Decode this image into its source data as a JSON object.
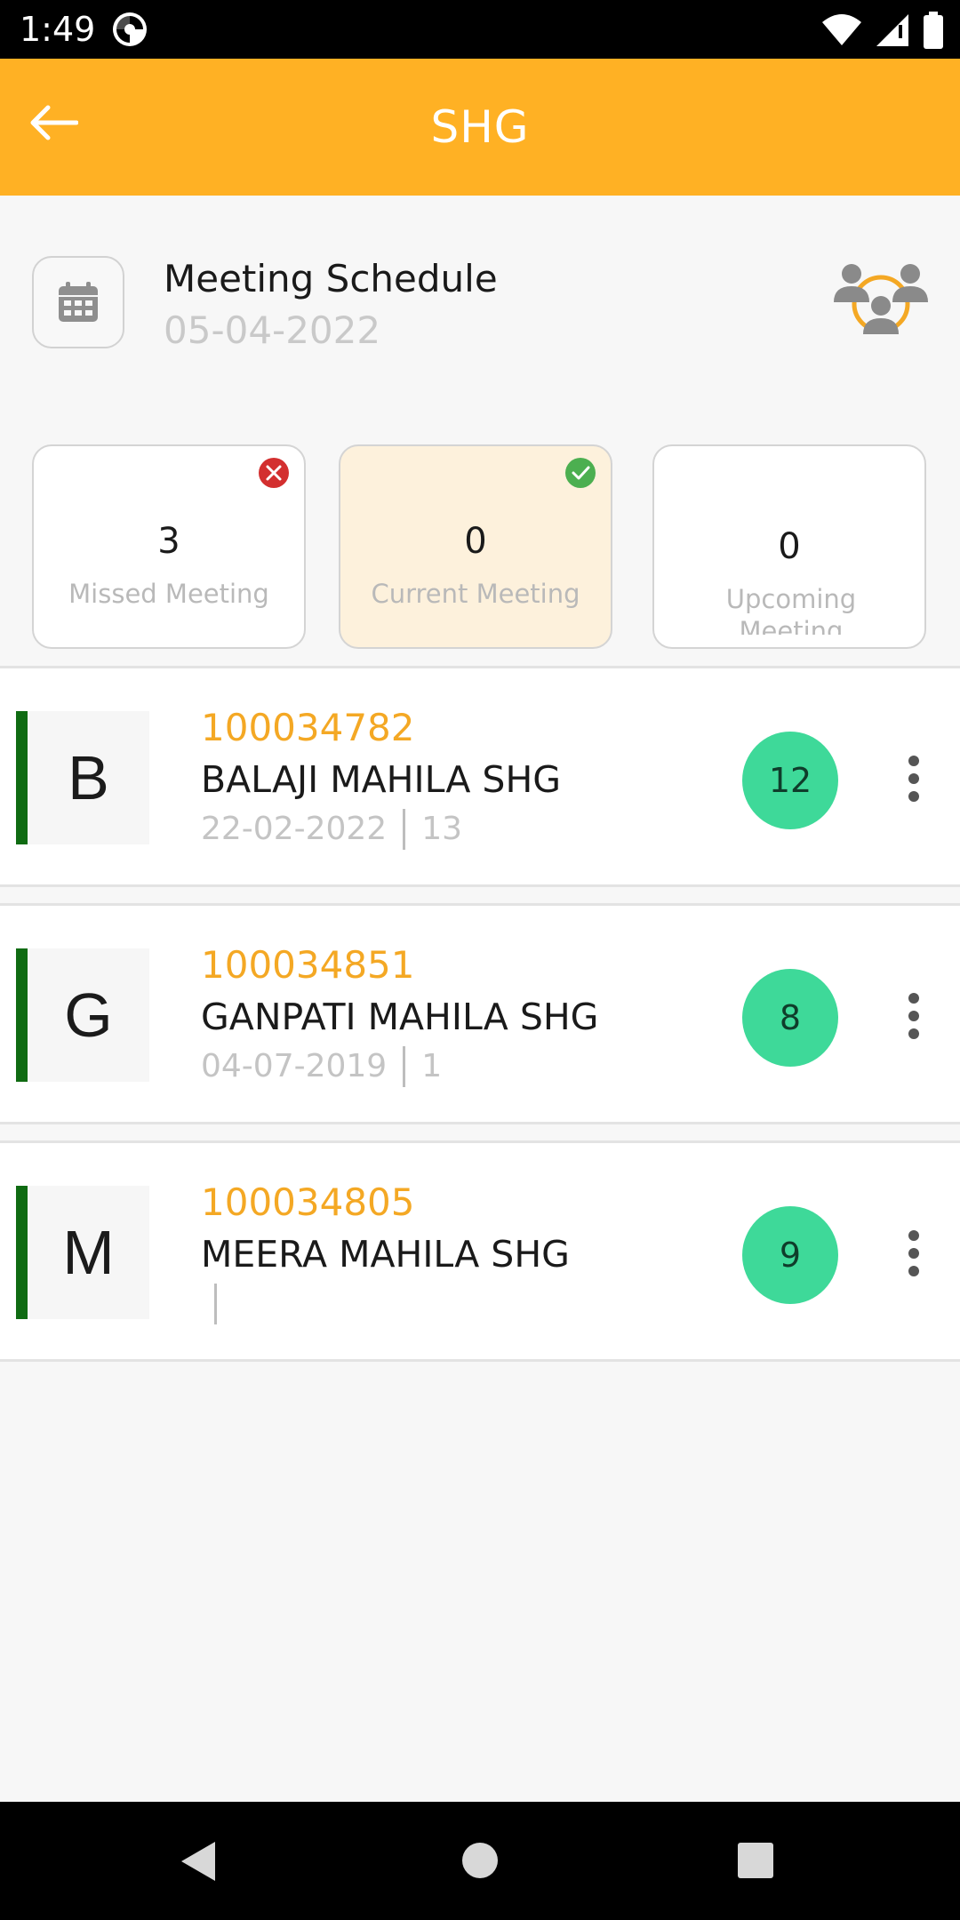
{
  "status_bar": {
    "time": "1:49"
  },
  "app_bar": {
    "title": "SHG"
  },
  "schedule": {
    "title": "Meeting Schedule",
    "date": "05-04-2022"
  },
  "meeting_cards": [
    {
      "count": "3",
      "label": "Missed Meeting",
      "status": "missed"
    },
    {
      "count": "0",
      "label": "Current Meeting",
      "status": "current"
    },
    {
      "count": "0",
      "label": "Upcoming Meeting",
      "status": "upcoming"
    }
  ],
  "groups": [
    {
      "initial": "B",
      "id": "100034782",
      "name": "BALAJI MAHILA SHG",
      "date": "22-02-2022",
      "extra": "13",
      "badge": "12"
    },
    {
      "initial": "G",
      "id": "100034851",
      "name": "GANPATI MAHILA SHG",
      "date": "04-07-2019",
      "extra": "1",
      "badge": "8"
    },
    {
      "initial": "M",
      "id": "100034805",
      "name": "MEERA MAHILA SHG",
      "date": "",
      "extra": "",
      "badge": "9"
    }
  ],
  "colors": {
    "app_bar": "#ffb124",
    "accent_id": "#f4a824",
    "badge": "#3ed999",
    "row_accent": "#0f6b12",
    "missed_icon": "#d32f2f",
    "current_icon": "#4caf50"
  },
  "icons": [
    "app-notification-icon",
    "wifi-icon",
    "signal-icon",
    "battery-icon",
    "back-arrow-icon",
    "calendar-icon",
    "group-meeting-icon",
    "missed-icon",
    "check-icon",
    "more-vert-icon",
    "nav-back-icon",
    "nav-home-icon",
    "nav-recents-icon"
  ]
}
